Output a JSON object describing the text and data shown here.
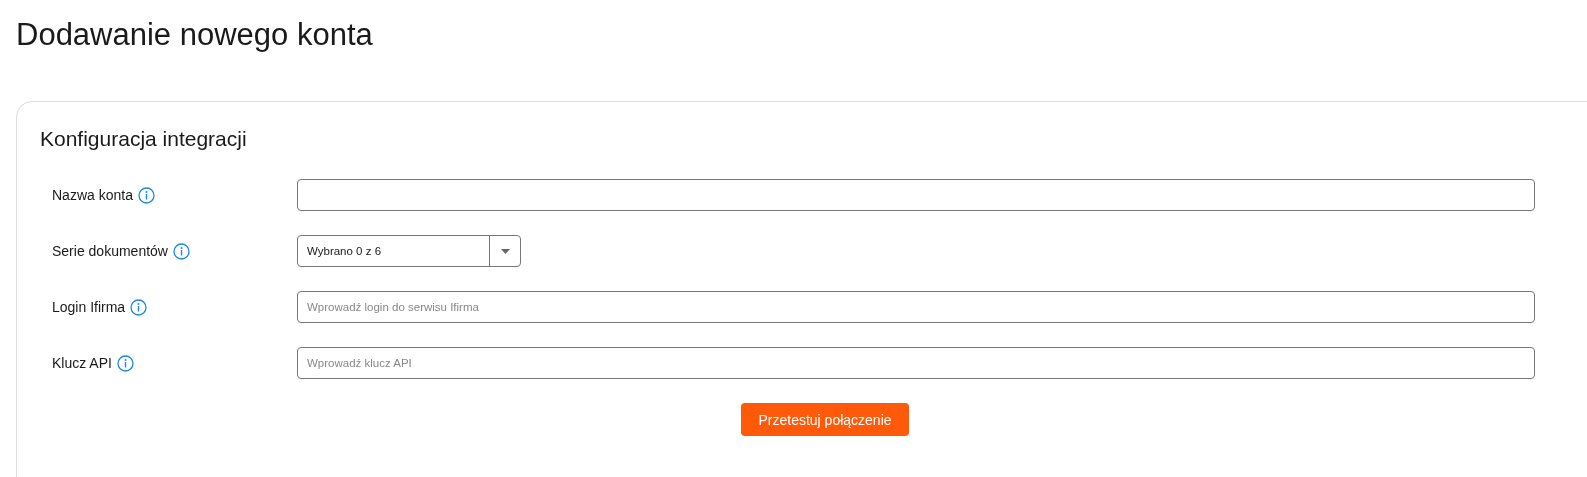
{
  "page_title": "Dodawanie nowego konta",
  "card": {
    "title": "Konfiguracja integracji",
    "fields": [
      {
        "kind": "text",
        "label": "Nazwa konta"
      },
      {
        "kind": "select",
        "label": "Serie dokumentów",
        "value": "Wybrano 0 z 6"
      },
      {
        "kind": "text",
        "label": "Login Ifirma",
        "placeholder": "Wprowadź login do serwisu Ifirma"
      },
      {
        "kind": "text",
        "label": "Klucz API",
        "placeholder": "Wprowadź klucz API"
      }
    ],
    "button": "Przetestuj połączenie"
  }
}
